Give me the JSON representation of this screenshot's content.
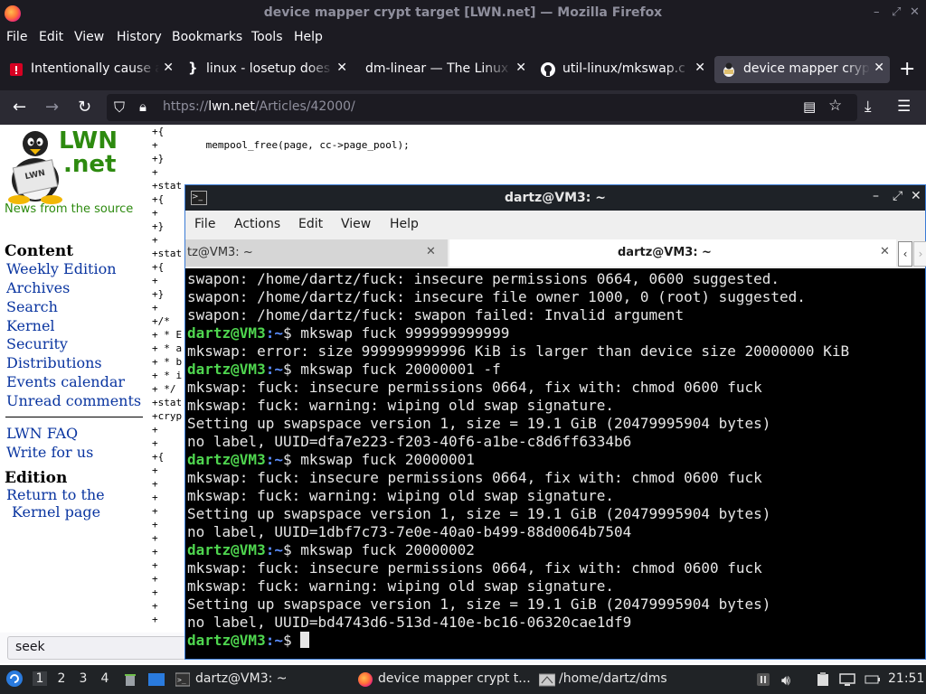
{
  "window": {
    "title": "device mapper crypt target [LWN.net] — Mozilla Firefox"
  },
  "menubar": {
    "items": [
      "File",
      "Edit",
      "View",
      "History",
      "Bookmarks",
      "Tools",
      "Help"
    ]
  },
  "tabs": [
    {
      "label": "Intentionally cause a",
      "icon": "warning-icon"
    },
    {
      "label": "linux - losetup does n",
      "icon": "stackexchange-icon"
    },
    {
      "label": "dm-linear — The Linux K",
      "icon": "none"
    },
    {
      "label": "util-linux/mkswap.c a",
      "icon": "github-icon"
    },
    {
      "label": "device mapper crypt",
      "icon": "lwn-icon",
      "active": true
    }
  ],
  "url": {
    "scheme": "https://",
    "host": "lwn.net",
    "path": "/Articles/42000/"
  },
  "lwn": {
    "logo_top": "LWN",
    "logo_bottom": ".net",
    "tagline": "News from the source",
    "content_heading": "Content",
    "content_links": [
      "Weekly Edition",
      "Archives",
      "Search",
      "Kernel",
      "Security",
      "Distributions",
      "Events calendar",
      "Unread comments"
    ],
    "extra_links": [
      "LWN FAQ",
      "Write for us"
    ],
    "edition_heading": "Edition",
    "edition_link_1": "Return to the",
    "edition_link_2": "Kernel page"
  },
  "code_lines": [
    "+{",
    "+        mempool_free(page, cc->page_pool);",
    "+}",
    "+",
    "+stat",
    "+{",
    "+",
    "+}",
    "+",
    "+stat",
    "+{",
    "+",
    "+}",
    "+",
    "+/*",
    "+ * E",
    "+ * a",
    "+ * b",
    "+ * i",
    "+ */",
    "+stat",
    "+cryp",
    "+",
    "+",
    "+{",
    "+",
    "+",
    "+",
    "+",
    "+",
    "+",
    "+",
    "+",
    "+",
    "+",
    "+",
    "+"
  ],
  "find": {
    "value": "seek"
  },
  "terminal": {
    "title": "dartz@VM3: ~",
    "menu": [
      "File",
      "Actions",
      "Edit",
      "View",
      "Help"
    ],
    "tabs": [
      "tz@VM3: ~",
      "dartz@VM3: ~"
    ],
    "lines": [
      {
        "t": "out",
        "text": "swapon: /home/dartz/fuck: insecure permissions 0664, 0600 suggested."
      },
      {
        "t": "out",
        "text": "swapon: /home/dartz/fuck: insecure file owner 1000, 0 (root) suggested."
      },
      {
        "t": "out",
        "text": "swapon: /home/dartz/fuck: swapon failed: Invalid argument"
      },
      {
        "t": "cmd",
        "user": "dartz@VM3",
        "path": ":~",
        "cmd": "$ mkswap fuck 999999999999"
      },
      {
        "t": "out",
        "text": "mkswap: error: size 999999999996 KiB is larger than device size 20000000 KiB"
      },
      {
        "t": "cmd",
        "user": "dartz@VM3",
        "path": ":~",
        "cmd": "$ mkswap fuck 20000001 -f"
      },
      {
        "t": "out",
        "text": "mkswap: fuck: insecure permissions 0664, fix with: chmod 0600 fuck"
      },
      {
        "t": "out",
        "text": "mkswap: fuck: warning: wiping old swap signature."
      },
      {
        "t": "out",
        "text": "Setting up swapspace version 1, size = 19.1 GiB (20479995904 bytes)"
      },
      {
        "t": "out",
        "text": "no label, UUID=dfa7e223-f203-40f6-a1be-c8d6ff6334b6"
      },
      {
        "t": "cmd",
        "user": "dartz@VM3",
        "path": ":~",
        "cmd": "$ mkswap fuck 20000001"
      },
      {
        "t": "out",
        "text": "mkswap: fuck: insecure permissions 0664, fix with: chmod 0600 fuck"
      },
      {
        "t": "out",
        "text": "mkswap: fuck: warning: wiping old swap signature."
      },
      {
        "t": "out",
        "text": "Setting up swapspace version 1, size = 19.1 GiB (20479995904 bytes)"
      },
      {
        "t": "out",
        "text": "no label, UUID=1dbf7c73-7e0e-40a0-b499-88d0064b7504"
      },
      {
        "t": "cmd",
        "user": "dartz@VM3",
        "path": ":~",
        "cmd": "$ mkswap fuck 20000002"
      },
      {
        "t": "out",
        "text": "mkswap: fuck: insecure permissions 0664, fix with: chmod 0600 fuck"
      },
      {
        "t": "out",
        "text": "mkswap: fuck: warning: wiping old swap signature."
      },
      {
        "t": "out",
        "text": "Setting up swapspace version 1, size = 19.1 GiB (20479995904 bytes)"
      },
      {
        "t": "out",
        "text": "no label, UUID=bd4743d6-513d-410e-bc16-06320cae1df9"
      },
      {
        "t": "cmd",
        "user": "dartz@VM3",
        "path": ":~",
        "cmd": "$ "
      }
    ]
  },
  "taskbar": {
    "workspaces": [
      "1",
      "2",
      "3",
      "4"
    ],
    "active_workspace": "1",
    "tasks": [
      "dartz@VM3: ~",
      "device mapper crypt t...",
      "/home/dartz/dms"
    ],
    "clock": "21:51"
  }
}
